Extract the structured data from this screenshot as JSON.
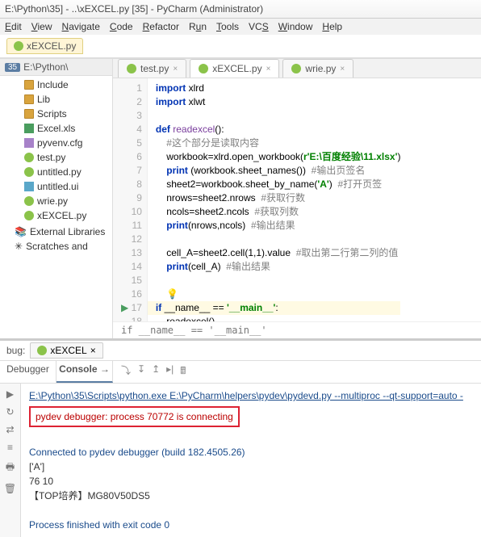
{
  "window": {
    "title": "E:\\Python\\35] - ..\\xEXCEL.py [35] - PyCharm (Administrator)"
  },
  "menu": {
    "edit": "Edit",
    "view": "View",
    "navigate": "Navigate",
    "code": "Code",
    "refactor": "Refactor",
    "run": "Run",
    "tools": "Tools",
    "vcs": "VCS",
    "window": "Window",
    "help": "Help"
  },
  "breadcrumb": {
    "file": "xEXCEL.py"
  },
  "project": {
    "num": "35",
    "root": "E:\\Python\\",
    "items": [
      {
        "icon": "folder",
        "label": "Include"
      },
      {
        "icon": "folder",
        "label": "Lib"
      },
      {
        "icon": "folder",
        "label": "Scripts"
      },
      {
        "icon": "xls",
        "label": "Excel.xls"
      },
      {
        "icon": "cfg",
        "label": "pyvenv.cfg"
      },
      {
        "icon": "py",
        "label": "test.py"
      },
      {
        "icon": "py",
        "label": "untitled.py"
      },
      {
        "icon": "ui",
        "label": "untitled.ui"
      },
      {
        "icon": "py",
        "label": "wrie.py"
      },
      {
        "icon": "py",
        "label": "xEXCEL.py"
      }
    ],
    "extra1": "External Libraries",
    "extra2": "Scratches and"
  },
  "editor": {
    "tabs": [
      {
        "icon": "py",
        "label": "test.py",
        "active": false
      },
      {
        "icon": "py",
        "label": "xEXCEL.py",
        "active": true
      },
      {
        "icon": "py",
        "label": "wrie.py",
        "active": false
      }
    ],
    "lines": [
      {
        "n": 1,
        "html": "<span class='kw'>import</span> <span class='id'>xlrd</span>"
      },
      {
        "n": 2,
        "html": "<span class='kw'>import</span> <span class='id'>xlwt</span>"
      },
      {
        "n": 3,
        "html": ""
      },
      {
        "n": 4,
        "html": "<span class='kw'>def</span> <span class='fn'>readexcel</span>():"
      },
      {
        "n": 5,
        "html": "    <span class='cm'>#这个部分是读取内容</span>"
      },
      {
        "n": 6,
        "html": "    workbook=xlrd.open_workbook(<span class='str'>r'E:\\百度经验\\11.xlsx'</span>)"
      },
      {
        "n": 7,
        "html": "    <span class='kw'>print</span> (workbook.sheet_names())  <span class='cm'>#输出页签名</span>"
      },
      {
        "n": 8,
        "html": "    sheet2=workbook.sheet_by_name(<span class='str'>'A'</span>)  <span class='cm'>#打开页签</span>"
      },
      {
        "n": 9,
        "html": "    nrows=sheet2.nrows  <span class='cm'>#获取行数</span>"
      },
      {
        "n": 10,
        "html": "    ncols=sheet2.ncols  <span class='cm'>#获取列数</span>"
      },
      {
        "n": 11,
        "html": "    <span class='kw'>print</span>(nrows,ncols)  <span class='cm'>#输出结果</span>"
      },
      {
        "n": 12,
        "html": ""
      },
      {
        "n": 13,
        "html": "    cell_A=sheet2.cell(1,1).value  <span class='cm'>#取出第二行第二列的值</span>"
      },
      {
        "n": 14,
        "html": "    <span class='kw'>print</span>(cell_A)  <span class='cm'>#输出结果</span>"
      },
      {
        "n": 15,
        "html": ""
      },
      {
        "n": 16,
        "html": "    <span class='bulb'>💡</span>"
      },
      {
        "n": 17,
        "html": "<span class='kw'>if</span> __name__ == <span class='str'>'__main__'</span>:",
        "hl": true,
        "run": true
      },
      {
        "n": 18,
        "html": "    readexcel()"
      }
    ],
    "crumb": "if __name__ == '__main__'"
  },
  "debug": {
    "title": "bug:",
    "run_tab": "xEXCEL",
    "sub": {
      "a": "Debugger",
      "b": "Console →"
    },
    "lines": [
      {
        "cls": "link",
        "text": "E:\\Python\\35\\Scripts\\python.exe E:\\PyCharm\\helpers\\pydev\\pydevd.py --multiproc --qt-support=auto -"
      },
      {
        "cls": "redbox",
        "text": "pydev debugger: process 70772 is connecting"
      },
      {
        "cls": "",
        "text": ""
      },
      {
        "cls": "blue",
        "text": "Connected to pydev debugger (build 182.4505.26)"
      },
      {
        "cls": "",
        "text": "['A']"
      },
      {
        "cls": "",
        "text": "76 10"
      },
      {
        "cls": "",
        "text": "【TOP培养】MG80V50DS5"
      },
      {
        "cls": "",
        "text": ""
      },
      {
        "cls": "blue",
        "text": "Process finished with exit code 0"
      }
    ]
  }
}
